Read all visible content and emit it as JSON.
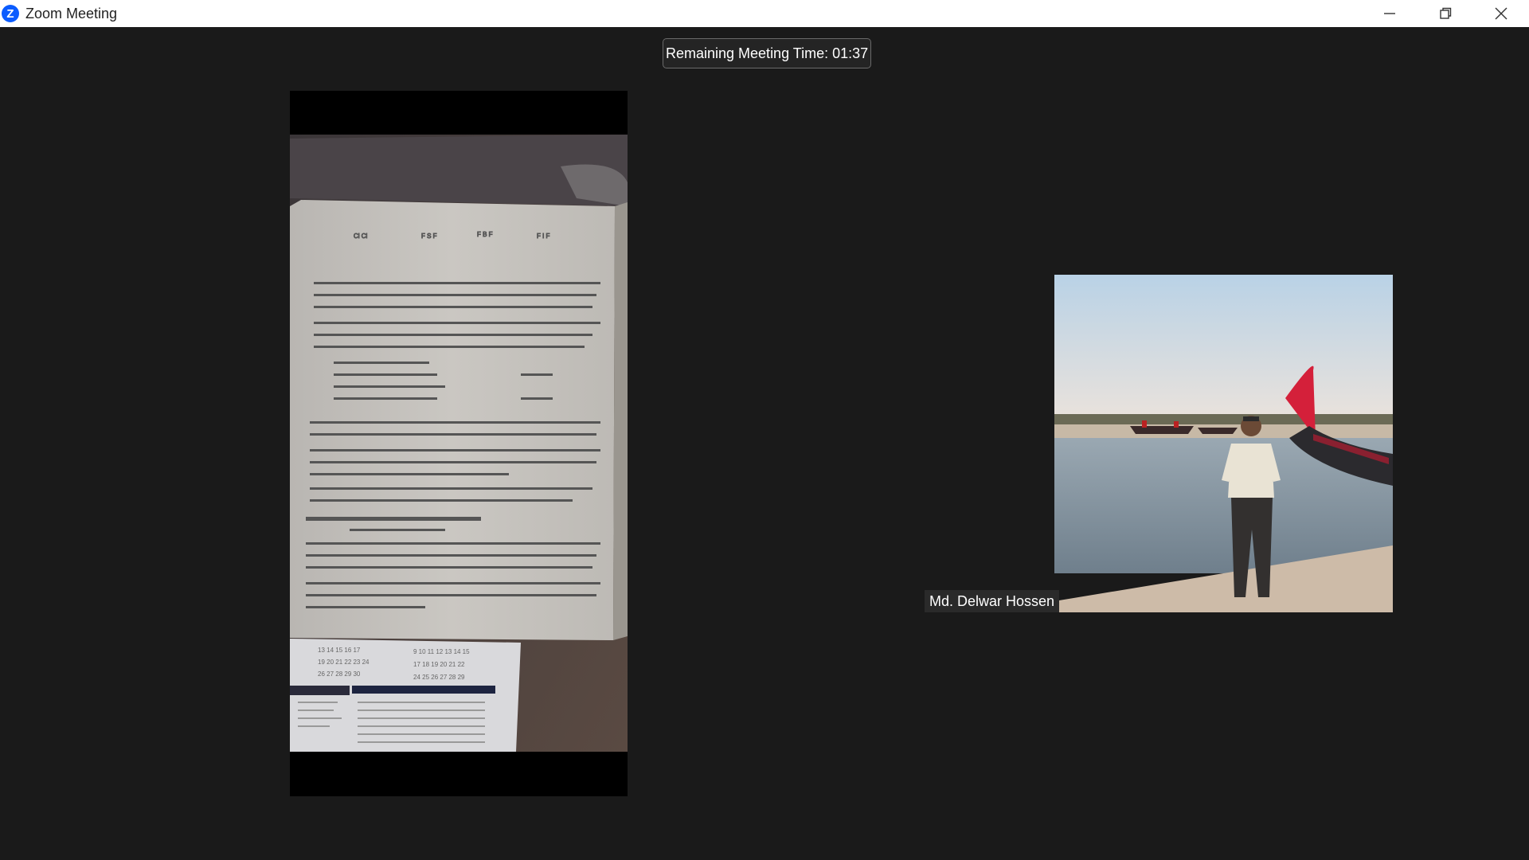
{
  "window": {
    "title": "Zoom Meeting",
    "logo_letter": "Z",
    "controls": {
      "minimize": "minimize-icon",
      "restore": "restore-icon",
      "close": "close-icon"
    }
  },
  "meeting": {
    "timer_text": "Remaining Meeting Time: 01:37"
  },
  "participants": [
    {
      "video": "textbook-page-camera-feed"
    },
    {
      "name": "Md. Delwar Hossen",
      "video": "man-standing-on-beach-with-boats"
    }
  ],
  "colors": {
    "background": "#1a1a1a",
    "titlebar": "#ffffff",
    "zoom_blue": "#0b5cff"
  }
}
